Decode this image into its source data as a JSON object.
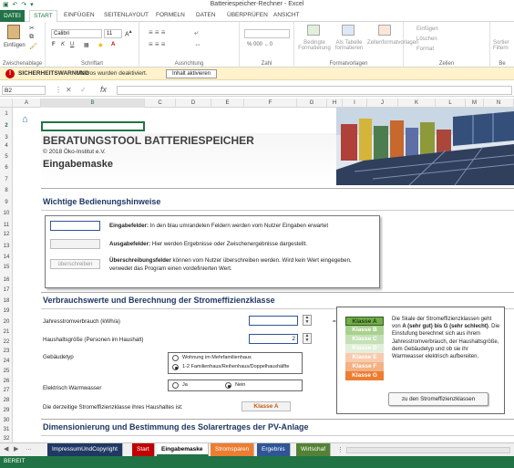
{
  "window": {
    "title": "Batteriespeicher-Rechner - Excel"
  },
  "ribbon_tabs": [
    "DATEI",
    "START",
    "EINFÜGEN",
    "SEITENLAYOUT",
    "FORMELN",
    "DATEN",
    "ÜBERPRÜFEN",
    "ANSICHT"
  ],
  "ribbon": {
    "paste_label": "Einfügen",
    "font_name": "Calibri",
    "font_size": "11",
    "bold": "F",
    "italic": "K",
    "underline": "U",
    "cond_format": "Bedingte Formatierung",
    "as_table": "Als Tabelle formatieren",
    "cell_styles": "Zellenformatvorlagen",
    "insert": "Einfügen",
    "delete": "Löschen",
    "format": "Format",
    "sort": "Sortier Filtern",
    "groups": [
      "Zwischenablage",
      "Schriftart",
      "Ausrichtung",
      "Zahl",
      "Formatvorlagen",
      "Zellen",
      "Be"
    ]
  },
  "security_bar": {
    "title": "SICHERHEITSWARNUNG",
    "message": "Makros wurden deaktiviert.",
    "button": "Inhalt aktivieren"
  },
  "formula_bar": {
    "name_box": "B2",
    "fx": "fx",
    "value": ""
  },
  "columns": [
    "A",
    "B",
    "C",
    "D",
    "E",
    "F",
    "G",
    "H",
    "I",
    "J",
    "K",
    "L",
    "M",
    "N"
  ],
  "rows": [
    "1",
    "2",
    "3",
    "4",
    "5",
    "6",
    "7",
    "8",
    "9",
    "10",
    "11",
    "12",
    "13",
    "14",
    "15",
    "16",
    "17",
    "18",
    "19",
    "20",
    "21",
    "22",
    "23",
    "24",
    "25",
    "26",
    "27",
    "28",
    "29",
    "30",
    "31",
    "32"
  ],
  "header": {
    "title": "BERATUNGSTOOL BATTERIESPEICHER",
    "copyright": "© 2018 Öko-Institut e.V.",
    "subtitle": "Eingabemaske"
  },
  "hints": {
    "title": "Wichtige Bedienungshinweise",
    "input_bold": "Eingabefelder:",
    "input_text": " In den blau umrandeten Feldern werden vom Nutzer Eingaben erwartet",
    "output_bold": "Ausgabefelder:",
    "output_text": " Hier werden Ergebnisse oder Zwischenergebnisse dargestellt.",
    "override_btn": "überschreiben",
    "override_bold": "Überschreibungsfelder",
    "override_text": " können vom Nutzer überschreiben werden. Wird kein Wert eingegeben, verwedet das Program einen vordefinierten Wert."
  },
  "consumption": {
    "title": "Verbrauchswerte und Berechnung der Stromeffizienzklasse",
    "annual_label": "Jahresstromverbrauch (kWh/a)",
    "annual_value": "",
    "household_label": "Haushaltsgröße (Personen im Haushalt)",
    "household_value": "2",
    "building_label": "Gebäudetyp",
    "building_options": [
      "Wohnung im Mehrfamilienhaus",
      "1-2 Familienhaus/Reihenhaus/Doppelhaushälfte"
    ],
    "building_selected": 1,
    "water_label": "Elektrisch Warmwasser",
    "water_options": [
      "Ja",
      "Nein"
    ],
    "water_selected": 1,
    "class_label": "Die derzeitige Stromeffizienzklasse ihres Haushaltes ist:",
    "class_value": "Klasse A"
  },
  "efficiency_panel": {
    "arrow": "===>",
    "classes": [
      {
        "label": "Klasse A",
        "color": "#70ad47"
      },
      {
        "label": "Klasse B",
        "color": "#a9d18e"
      },
      {
        "label": "Klasse C",
        "color": "#c5e0b4"
      },
      {
        "label": "Klasse D",
        "color": "#e2efda"
      },
      {
        "label": "Klasse E",
        "color": "#f8cbad"
      },
      {
        "label": "Klasse F",
        "color": "#f4b183"
      },
      {
        "label": "Klasse G",
        "color": "#ed7d31"
      }
    ],
    "text_pre": "Die Skale der Stromeffizienzklassen geht von ",
    "text_bold": "A (sehr gut) bis G (sehr schlecht)",
    "text_post": ". Die Einstufung berechnet sich aus ihrem Jahresstromverbrauch, der Haushaltsgröße, dem Gebäudetyp und ob sie ihr Warmwasser elektrisch aufbereiten.",
    "button": "zu den Stromeffizienzklassen"
  },
  "pv": {
    "title": "Dimensionierung und Bestimmung des Solarertrages der PV-Anlage"
  },
  "sheet_tabs": [
    {
      "label": "ImpressumUndCopyright",
      "color": "#1f3864",
      "text": "#ffffff"
    },
    {
      "label": "Start",
      "color": "#c00000",
      "text": "#ffffff"
    },
    {
      "label": "Eingabemaske",
      "color": "#ffffff",
      "text": "#000000"
    },
    {
      "label": "Stromsparen",
      "color": "#ed7d31",
      "text": "#ffffff"
    },
    {
      "label": "Ergebnis",
      "color": "#2f5597",
      "text": "#ffffff"
    },
    {
      "label": "Wirtschaf",
      "color": "#548235",
      "text": "#ffffff"
    }
  ],
  "status": {
    "text": "BEREIT"
  },
  "colors": {
    "excel_green": "#217346",
    "title_blue": "#1f3864",
    "input_border": "#2f5597"
  }
}
